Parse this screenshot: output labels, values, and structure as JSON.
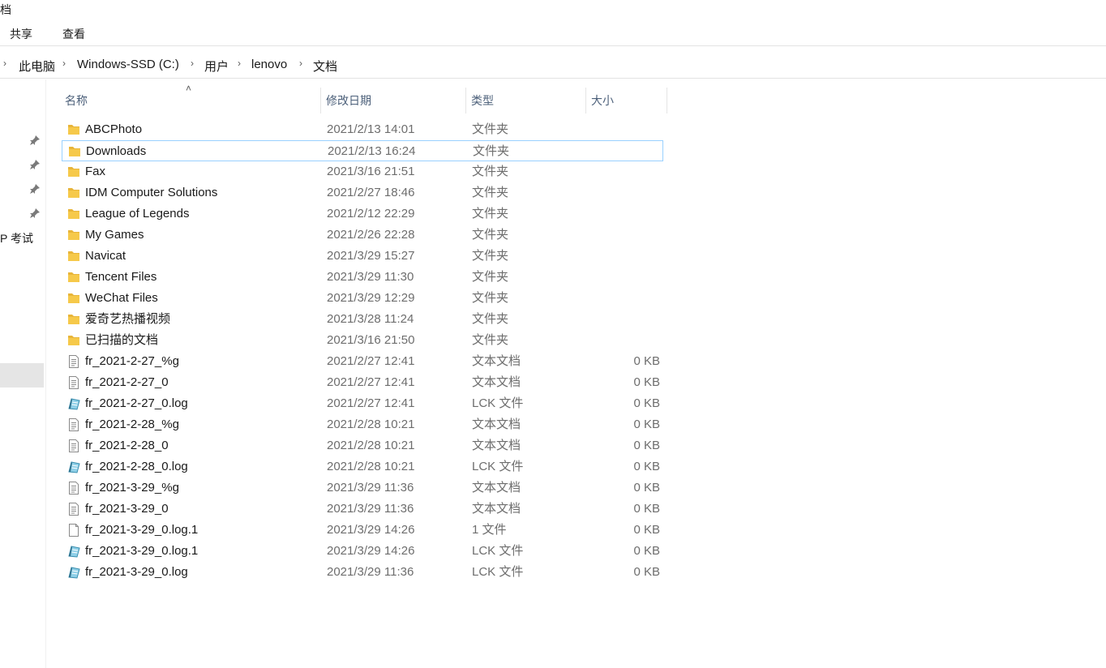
{
  "window": {
    "title_fragment": "档"
  },
  "ribbon": {
    "tabs": [
      {
        "label": "共享"
      },
      {
        "label": "查看"
      }
    ]
  },
  "address_bar": {
    "crumbs": [
      {
        "label": "此电脑"
      },
      {
        "label": "Windows-SSD (C:)"
      },
      {
        "label": "用户"
      },
      {
        "label": "lenovo"
      },
      {
        "label": "文档"
      }
    ]
  },
  "nav_pane": {
    "truncated_item": "P 考试"
  },
  "columns": {
    "name": "名称",
    "modified": "修改日期",
    "type": "类型",
    "size": "大小"
  },
  "files": [
    {
      "name": "ABCPhoto",
      "modified": "2021/2/13 14:01",
      "type": "文件夹",
      "size": "",
      "icon": "folder-icon"
    },
    {
      "name": "Downloads",
      "modified": "2021/2/13 16:24",
      "type": "文件夹",
      "size": "",
      "icon": "folder-icon"
    },
    {
      "name": "Fax",
      "modified": "2021/3/16 21:51",
      "type": "文件夹",
      "size": "",
      "icon": "folder-icon"
    },
    {
      "name": "IDM Computer Solutions",
      "modified": "2021/2/27 18:46",
      "type": "文件夹",
      "size": "",
      "icon": "folder-icon"
    },
    {
      "name": "League of Legends",
      "modified": "2021/2/12 22:29",
      "type": "文件夹",
      "size": "",
      "icon": "folder-icon"
    },
    {
      "name": "My Games",
      "modified": "2021/2/26 22:28",
      "type": "文件夹",
      "size": "",
      "icon": "folder-icon"
    },
    {
      "name": "Navicat",
      "modified": "2021/3/29 15:27",
      "type": "文件夹",
      "size": "",
      "icon": "folder-icon"
    },
    {
      "name": "Tencent Files",
      "modified": "2021/3/29 11:30",
      "type": "文件夹",
      "size": "",
      "icon": "folder-icon"
    },
    {
      "name": "WeChat Files",
      "modified": "2021/3/29 12:29",
      "type": "文件夹",
      "size": "",
      "icon": "folder-icon"
    },
    {
      "name": "爱奇艺热播视频",
      "modified": "2021/3/28 11:24",
      "type": "文件夹",
      "size": "",
      "icon": "folder-icon"
    },
    {
      "name": "已扫描的文档",
      "modified": "2021/3/16 21:50",
      "type": "文件夹",
      "size": "",
      "icon": "folder-icon"
    },
    {
      "name": "fr_2021-2-27_%g",
      "modified": "2021/2/27 12:41",
      "type": "文本文档",
      "size": "0 KB",
      "icon": "text-file-icon"
    },
    {
      "name": "fr_2021-2-27_0",
      "modified": "2021/2/27 12:41",
      "type": "文本文档",
      "size": "0 KB",
      "icon": "text-file-icon"
    },
    {
      "name": "fr_2021-2-27_0.log",
      "modified": "2021/2/27 12:41",
      "type": "LCK 文件",
      "size": "0 KB",
      "icon": "lck-file-icon"
    },
    {
      "name": "fr_2021-2-28_%g",
      "modified": "2021/2/28 10:21",
      "type": "文本文档",
      "size": "0 KB",
      "icon": "text-file-icon"
    },
    {
      "name": "fr_2021-2-28_0",
      "modified": "2021/2/28 10:21",
      "type": "文本文档",
      "size": "0 KB",
      "icon": "text-file-icon"
    },
    {
      "name": "fr_2021-2-28_0.log",
      "modified": "2021/2/28 10:21",
      "type": "LCK 文件",
      "size": "0 KB",
      "icon": "lck-file-icon"
    },
    {
      "name": "fr_2021-3-29_%g",
      "modified": "2021/3/29 11:36",
      "type": "文本文档",
      "size": "0 KB",
      "icon": "text-file-icon"
    },
    {
      "name": "fr_2021-3-29_0",
      "modified": "2021/3/29 11:36",
      "type": "文本文档",
      "size": "0 KB",
      "icon": "text-file-icon"
    },
    {
      "name": "fr_2021-3-29_0.log.1",
      "modified": "2021/3/29 14:26",
      "type": "1 文件",
      "size": "0 KB",
      "icon": "blank-file-icon"
    },
    {
      "name": "fr_2021-3-29_0.log.1",
      "modified": "2021/3/29 14:26",
      "type": "LCK 文件",
      "size": "0 KB",
      "icon": "lck-file-icon"
    },
    {
      "name": "fr_2021-3-29_0.log",
      "modified": "2021/3/29 11:36",
      "type": "LCK 文件",
      "size": "0 KB",
      "icon": "lck-file-icon"
    }
  ],
  "colors": {
    "folder": "#f6c94a",
    "focus_border": "#99d1ff",
    "header_text": "#4c607a"
  }
}
